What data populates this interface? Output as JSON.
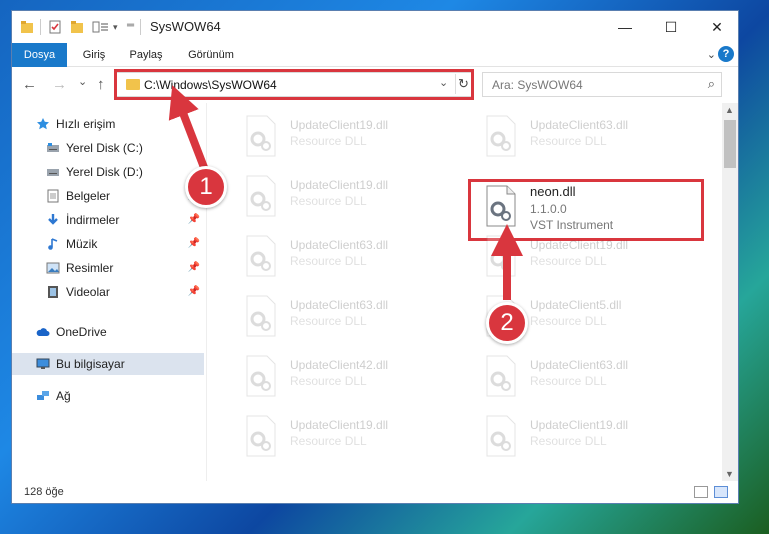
{
  "window": {
    "title": "SysWOW64",
    "minimize_glyph": "—",
    "maximize_glyph": "☐",
    "close_glyph": "✕"
  },
  "ribbon": {
    "tabs": [
      "Dosya",
      "Giriş",
      "Paylaş",
      "Görünüm"
    ],
    "help_glyph": "?"
  },
  "nav": {
    "back_glyph": "←",
    "forward_glyph": "→",
    "recent_glyph": "⌄",
    "up_glyph": "↑",
    "address": "C:\\Windows\\SysWOW64",
    "search_placeholder": "Ara: SysWOW64"
  },
  "sidebar": {
    "items": [
      {
        "label": "Hızlı erişim",
        "icon": "star-icon",
        "pinned": false
      },
      {
        "label": "Yerel Disk (C:)",
        "icon": "drive-icon",
        "pinned": false
      },
      {
        "label": "Yerel Disk (D:)",
        "icon": "drive-icon",
        "pinned": false
      },
      {
        "label": "Belgeler",
        "icon": "document-icon",
        "pinned": true
      },
      {
        "label": "İndirmeler",
        "icon": "download-icon",
        "pinned": true
      },
      {
        "label": "Müzik",
        "icon": "music-icon",
        "pinned": true
      },
      {
        "label": "Resimler",
        "icon": "pictures-icon",
        "pinned": true
      },
      {
        "label": "Videolar",
        "icon": "video-icon",
        "pinned": true
      },
      {
        "label": "OneDrive",
        "icon": "cloud-icon",
        "pinned": false
      },
      {
        "label": "Bu bilgisayar",
        "icon": "computer-icon",
        "pinned": false,
        "selected": true
      },
      {
        "label": "Ağ",
        "icon": "network-icon",
        "pinned": false
      }
    ]
  },
  "files": {
    "left": [
      {
        "name": "UpdateClient19.dll",
        "desc": "Resource DLL"
      },
      {
        "name": "UpdateClient19.dll",
        "desc": "Resource DLL"
      },
      {
        "name": "UpdateClient63.dll",
        "desc": "Resource DLL"
      },
      {
        "name": "UpdateClient63.dll",
        "desc": "Resource DLL"
      },
      {
        "name": "UpdateClient42.dll",
        "desc": "Resource DLL"
      },
      {
        "name": "UpdateClient19.dll",
        "desc": "Resource DLL"
      }
    ],
    "right": [
      {
        "name": "UpdateClient63.dll",
        "desc": "Resource DLL"
      },
      {
        "name": "UpdateClient19.dll",
        "desc": "Resource DLL"
      },
      {
        "name": "UpdateClient5.dll",
        "desc": "Resource DLL"
      },
      {
        "name": "UpdateClient63.dll",
        "desc": "Resource DLL"
      },
      {
        "name": "UpdateClient19.dll",
        "desc": "Resource DLL"
      }
    ],
    "highlighted": {
      "name": "neon.dll",
      "version": "1.1.0.0",
      "desc": "VST Instrument"
    }
  },
  "status": {
    "count": "128 öğe"
  },
  "annotations": {
    "step1": "1",
    "step2": "2",
    "color": "#d9363e"
  },
  "colors": {
    "accent": "#1979ca",
    "highlight": "#d9363e",
    "selected_bg": "#dbe3ee"
  }
}
